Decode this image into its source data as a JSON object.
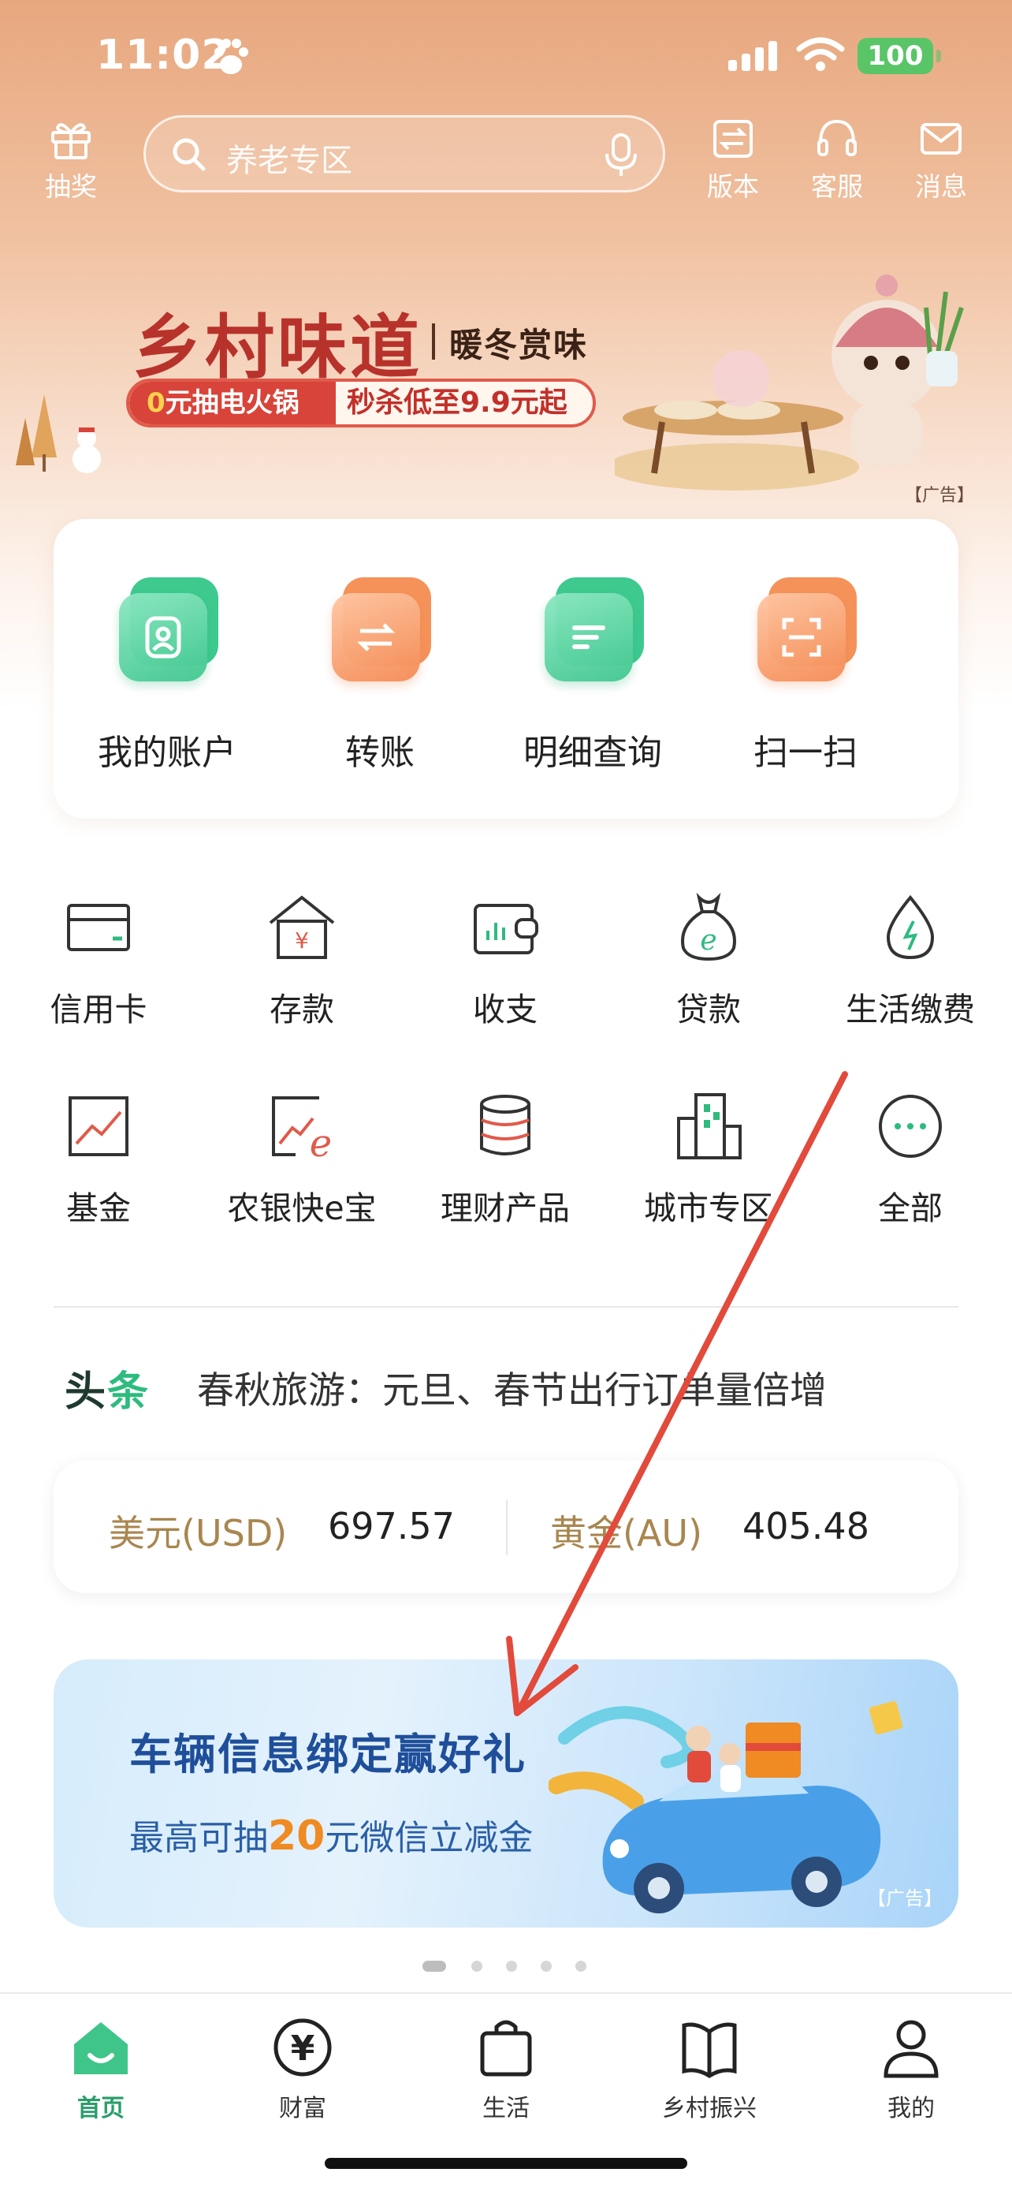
{
  "status_bar": {
    "time": "11:02",
    "battery": "100"
  },
  "header": {
    "lottery_label": "抽奖",
    "search_placeholder": "养老专区",
    "version_label": "版本",
    "service_label": "客服",
    "message_label": "消息"
  },
  "banner": {
    "title": "乡村味道",
    "subtitle": "暖冬赏味",
    "promo_left_prefix": "0",
    "promo_left": "元抽电火锅",
    "promo_right": "秒杀低至9.9元起",
    "ad_tag": "【广告】"
  },
  "quick_actions": [
    {
      "label": "我的账户",
      "icon": "account-icon",
      "color": "green"
    },
    {
      "label": "转账",
      "icon": "transfer-icon",
      "color": "orange"
    },
    {
      "label": "明细查询",
      "icon": "details-icon",
      "color": "green"
    },
    {
      "label": "扫一扫",
      "icon": "scan-icon",
      "color": "orange"
    }
  ],
  "grid": [
    {
      "label": "信用卡",
      "icon": "credit-card-icon"
    },
    {
      "label": "存款",
      "icon": "deposit-icon"
    },
    {
      "label": "收支",
      "icon": "wallet-icon"
    },
    {
      "label": "贷款",
      "icon": "loan-bag-icon"
    },
    {
      "label": "生活缴费",
      "icon": "utility-drop-icon"
    },
    {
      "label": "基金",
      "icon": "fund-chart-icon"
    },
    {
      "label": "农银快e宝",
      "icon": "quick-e-icon"
    },
    {
      "label": "理财产品",
      "icon": "coin-stack-icon"
    },
    {
      "label": "城市专区",
      "icon": "city-buildings-icon"
    },
    {
      "label": "全部",
      "icon": "more-dots-icon"
    }
  ],
  "headline": {
    "tag_a": "头",
    "tag_b": "条",
    "text": "春秋旅游：元旦、春节出行订单量倍增"
  },
  "rates": [
    {
      "name": "美元(USD)",
      "value": "697.57"
    },
    {
      "name": "黄金(AU)",
      "value": "405.48"
    }
  ],
  "car_ad": {
    "title": "车辆信息绑定赢好礼",
    "sub_prefix": "最高可抽",
    "sub_highlight": "20",
    "sub_suffix": "元微信立减金",
    "ad_tag": "【广告】"
  },
  "tabs": [
    {
      "label": "首页",
      "icon": "home-icon",
      "active": true
    },
    {
      "label": "财富",
      "icon": "wealth-yen-icon",
      "active": false
    },
    {
      "label": "生活",
      "icon": "shopping-bag-icon",
      "active": false
    },
    {
      "label": "乡村振兴",
      "icon": "book-icon",
      "active": false
    },
    {
      "label": "我的",
      "icon": "profile-icon",
      "active": false
    }
  ],
  "colors": {
    "accent_green": "#2dbb7e",
    "accent_orange": "#f4925a",
    "annotation_red": "#e24a3b"
  }
}
